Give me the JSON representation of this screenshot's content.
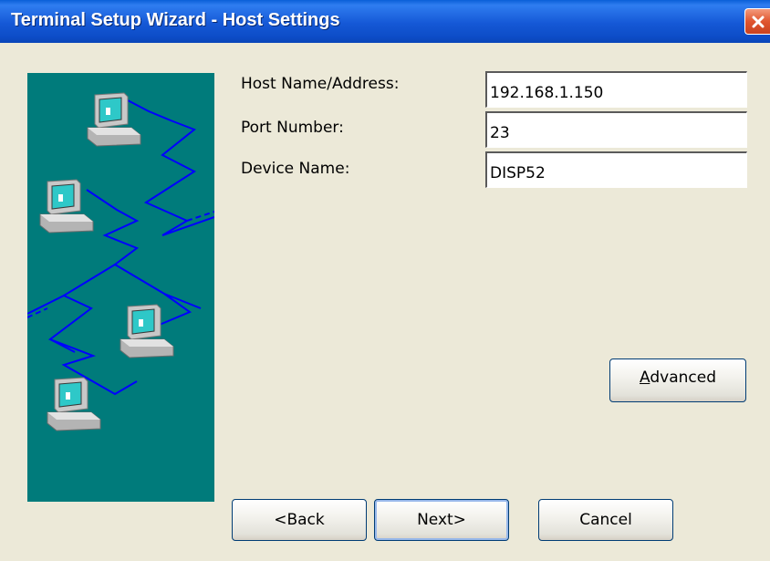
{
  "window": {
    "title": "Terminal Setup Wizard - Host Settings",
    "close_icon": "close-icon"
  },
  "form": {
    "host": {
      "label": "Host Name/Address:",
      "value": "192.168.1.150"
    },
    "port": {
      "label": "Port Number:",
      "value": "23"
    },
    "device": {
      "label": "Device Name:",
      "value": "DISP52"
    }
  },
  "buttons": {
    "advanced": {
      "accel": "A",
      "rest": "dvanced"
    },
    "back": "<Back",
    "next": "Next>",
    "cancel": "Cancel"
  },
  "colors": {
    "titlebar": "#0a5fd8",
    "illustration_bg": "#007b7b",
    "network_line": "#0000ff",
    "dialog_bg": "#ece9d8"
  }
}
